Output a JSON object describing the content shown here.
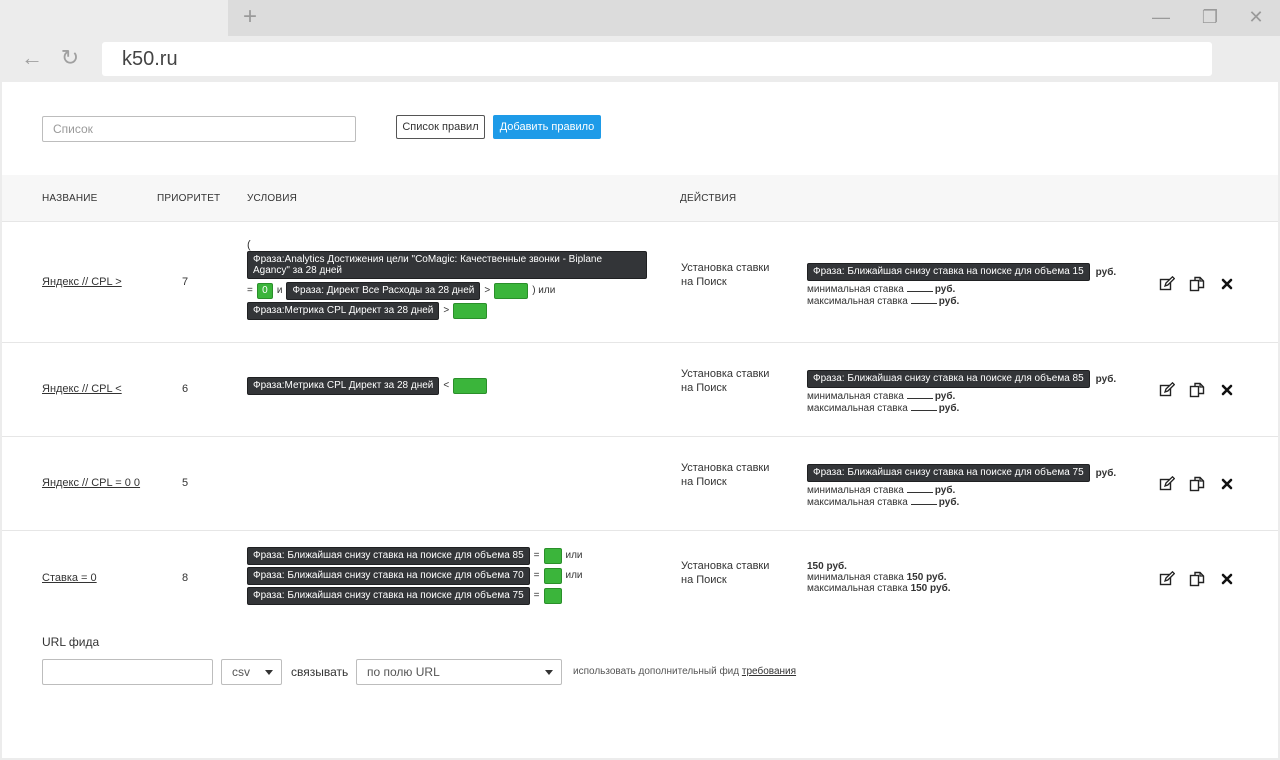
{
  "browser": {
    "address": "k50.ru",
    "new_tab": "+",
    "minimize": "—",
    "restore": "❐",
    "close": "✕",
    "back": "←",
    "reload": "↻"
  },
  "toolbar": {
    "search_placeholder": "Список",
    "rules_list_label": "Список правил",
    "add_rule_label": "Добавить правило"
  },
  "table": {
    "headers": {
      "name": "НАЗВАНИЕ",
      "priority": "ПРИОРИТЕТ",
      "conditions": "УСЛОВИЯ",
      "actions": "ДЕЙСТВИЯ"
    },
    "rows": [
      {
        "name": "Яндекс // CPL >",
        "priority": "7",
        "cond_open": "(",
        "cond_tag1": "Фраза:Analytics Достижения цели \"CoMagic: Качественные звонки - Biplane Agancy\" за 28 дней",
        "cond_eq": "=",
        "cond_val": "0",
        "cond_and": "и",
        "cond_tag2": "Фраза: Директ Все Расходы за 28 дней",
        "cond_gt": ">",
        "cond_close_or": ") или",
        "cond_tag3": "Фраза:Метрика CPL Директ за 28 дней",
        "cond_gt2": ">",
        "action": "Установка ставки на Поиск",
        "bid_tag": "Фраза: Ближайшая снизу ставка на поиске для объема 15",
        "rub": "руб.",
        "min_label": "минимальная ставка",
        "max_label": "максимальная ставка",
        "min_rub": "руб.",
        "max_rub": "руб."
      },
      {
        "name": "Яндекс // CPL <",
        "priority": "6",
        "cond_tag1": "Фраза:Метрика CPL Директ за 28 дней",
        "cond_lt": "<",
        "action": "Установка ставки на Поиск",
        "bid_tag": "Фраза: Ближайшая снизу ставка на поиске для объема 85",
        "rub": "руб.",
        "min_label": "минимальная ставка",
        "max_label": "максимальная ставка",
        "min_rub": "руб.",
        "max_rub": "руб."
      },
      {
        "name": "Яндекс // CPL = 0 0",
        "priority": "5",
        "action": "Установка ставки на Поиск",
        "bid_tag": "Фраза: Ближайшая снизу ставка на поиске для объема 75",
        "rub": "руб.",
        "min_label": "минимальная ставка",
        "max_label": "максимальная ставка",
        "min_rub": "руб.",
        "max_rub": "руб."
      },
      {
        "name": "Ставка = 0",
        "priority": "8",
        "cond_tag1": "Фраза: Ближайшая снизу ставка на поиске для объема 85",
        "cond_tag2": "Фраза: Ближайшая снизу ставка на поиске для объема 70",
        "cond_tag3": "Фраза: Ближайшая снизу ставка на поиске для объема 75",
        "cond_eq": "=",
        "cond_or": "или",
        "action": "Установка ставки на Поиск",
        "bid_value": "150",
        "rub": "руб.",
        "min_label": "минимальная ставка",
        "min_value": "150",
        "min_rub": "руб.",
        "max_label": "максимальная ставка",
        "max_value": "150",
        "max_rub": "руб."
      }
    ]
  },
  "footer": {
    "url_label": "URL фида",
    "format_value": "csv",
    "link_label": "связывать",
    "field_value": "по полю URL",
    "hint_text": "использовать дополнительный фид",
    "hint_link": "требования"
  }
}
